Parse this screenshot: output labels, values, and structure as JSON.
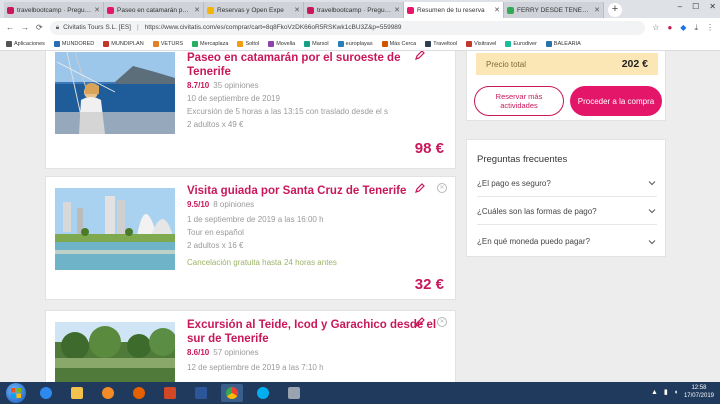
{
  "tabs": [
    {
      "label": "travelbootcamp · Preguntas",
      "color": "#c8185a"
    },
    {
      "label": "Paseo en catamarán por el s",
      "color": "#e4166a"
    },
    {
      "label": "Reservas y Open Expe",
      "color": "#f4b400"
    },
    {
      "label": "travelbootcamp · Preguntas",
      "color": "#c8185a"
    },
    {
      "label": "Resumen de tu reserva",
      "color": "#e4166a",
      "active": true
    },
    {
      "label": "FERRY DESDE TENERIF",
      "color": "#34a853"
    }
  ],
  "address": {
    "site": "Civitatis Tours S.L. [ES]",
    "url": "https://www.civitatis.com/es/comprar/cart=8q8FkoVzDK66oR5RSKwk1cBU3Z&p=559989"
  },
  "bookmarks": [
    {
      "label": "Aplicaciones",
      "color": "#555555"
    },
    {
      "label": "MUNDORED",
      "color": "#2c6eb5"
    },
    {
      "label": "MUNDIPLAN",
      "color": "#c0392b"
    },
    {
      "label": "VETURS",
      "color": "#e67e22"
    },
    {
      "label": "Mercaplaza",
      "color": "#27ae60"
    },
    {
      "label": "Soltol",
      "color": "#f39c12"
    },
    {
      "label": "Movella",
      "color": "#8e44ad"
    },
    {
      "label": "Marsol",
      "color": "#16a085"
    },
    {
      "label": "europlayas",
      "color": "#2980b9"
    },
    {
      "label": "Más Cerca",
      "color": "#d35400"
    },
    {
      "label": "Traveltool",
      "color": "#2c3e50"
    },
    {
      "label": "Visitravel",
      "color": "#c0392b"
    },
    {
      "label": "Eurodiver",
      "color": "#1abc9c"
    },
    {
      "label": "BALEARIA",
      "color": "#2874a6"
    }
  ],
  "cards": [
    {
      "title": "Paseo en catamarán por el suroeste de Tenerife",
      "score": "8.7/10",
      "reviews": "35 opiniones",
      "date": "10 de septiembre de 2019",
      "detail": "Excursión de 5 horas a las 13:15 con traslado desde el s",
      "people": "2 adultos x 49 €",
      "cancel": "",
      "price": "98 €"
    },
    {
      "title": "Visita guiada por Santa Cruz de Tenerife",
      "score": "9.5/10",
      "reviews": "8 opiniones",
      "date": "1 de septiembre de 2019 a las 16:00 h",
      "detail": "Tour en español",
      "people": "2 adultos x 16 €",
      "cancel": "Cancelación gratuita hasta 24 horas antes",
      "price": "32 €"
    },
    {
      "title": "Excursión al Teide, Icod y Garachico desde el sur de Tenerife",
      "score": "8.6/10",
      "reviews": "57 opiniones",
      "date": "12 de septiembre de 2019 a las 7:10 h",
      "detail": "",
      "people": "",
      "cancel": "",
      "price": ""
    }
  ],
  "summary": {
    "total_label": "Precio total",
    "total_amount": "202 €",
    "reserve_label": "Reservar más actividades",
    "checkout_label": "Proceder a la compra"
  },
  "faq": {
    "title": "Preguntas frecuentes",
    "items": [
      "¿El pago es seguro?",
      "¿Cuáles son las formas de pago?",
      "¿En qué moneda puedo pagar?"
    ]
  },
  "taskbar": {
    "time": "12:58",
    "date": "17/07/2019"
  },
  "colors": {
    "brand": "#c8185a",
    "checkout": "#e4166a",
    "total_bg": "#fbe7b6",
    "cancel_text": "#9bb36a",
    "taskbar": "#1f3a5c"
  }
}
